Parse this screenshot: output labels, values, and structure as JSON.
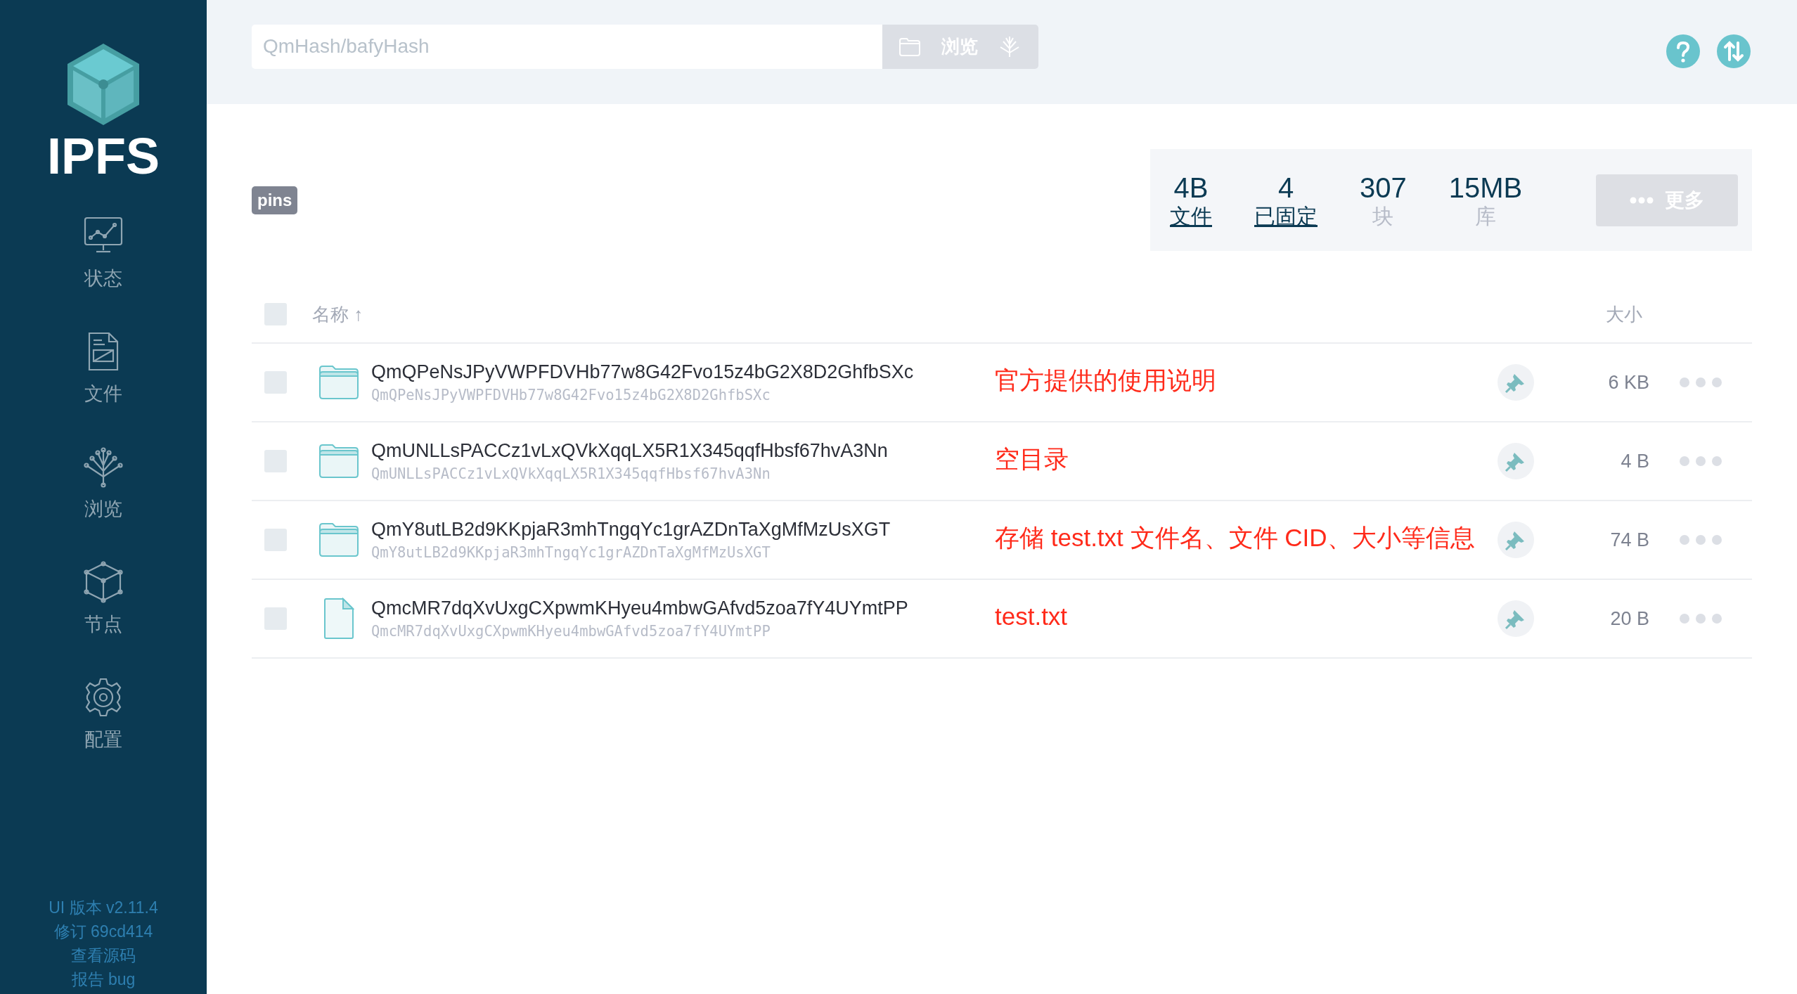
{
  "sidebar": {
    "logo": "IPFS",
    "nav": [
      {
        "label": "状态"
      },
      {
        "label": "文件"
      },
      {
        "label": "浏览"
      },
      {
        "label": "节点"
      },
      {
        "label": "配置"
      }
    ],
    "footer": [
      "UI 版本 v2.11.4",
      "修订 69cd414",
      "查看源码",
      "报告 bug"
    ]
  },
  "search": {
    "placeholder": "QmHash/bafyHash",
    "button": "浏览"
  },
  "filter_tag": "pins",
  "stats": [
    {
      "value": "4B",
      "label": "文件",
      "link": true
    },
    {
      "value": "4",
      "label": "已固定",
      "link": true
    },
    {
      "value": "307",
      "label": "块",
      "link": false
    },
    {
      "value": "15MB",
      "label": "库",
      "link": false
    }
  ],
  "more_button": "更多",
  "table": {
    "all_checked": false,
    "columns": [
      "名称 ↑",
      "大小"
    ],
    "rows": [
      {
        "kind": "folder",
        "name": "QmQPeNsJPyVWPFDVHb77w8G42Fvo15z4bG2X8D2GhfbSXc",
        "cid": "QmQPeNsJPyVWPFDVHb77w8G42Fvo15z4bG2X8D2GhfbSXc",
        "annotation": "官方提供的使用说明",
        "size": "6 KB",
        "checked": false,
        "pinned": true
      },
      {
        "kind": "folder",
        "name": "QmUNLLsPACCz1vLxQVkXqqLX5R1X345qqfHbsf67hvA3Nn",
        "cid": "QmUNLLsPACCz1vLxQVkXqqLX5R1X345qqfHbsf67hvA3Nn",
        "annotation": "空目录",
        "size": "4 B",
        "checked": false,
        "pinned": true
      },
      {
        "kind": "folder",
        "name": "QmY8utLB2d9KKpjaR3mhTngqYc1grAZDnTaXgMfMzUsXGT",
        "cid": "QmY8utLB2d9KKpjaR3mhTngqYc1grAZDnTaXgMfMzUsXGT",
        "annotation": "存储 test.txt 文件名、文件 CID、大小等信息",
        "size": "74 B",
        "checked": false,
        "pinned": true
      },
      {
        "kind": "file",
        "name": "QmcMR7dqXvUxgCXpwmKHyeu4mbwGAfvd5zoa7fY4UYmtPP",
        "cid": "QmcMR7dqXvUxgCXpwmKHyeu4mbwGAfvd5zoa7fY4UYmtPP",
        "annotation": "test.txt",
        "size": "20 B",
        "checked": false,
        "pinned": true
      }
    ]
  }
}
